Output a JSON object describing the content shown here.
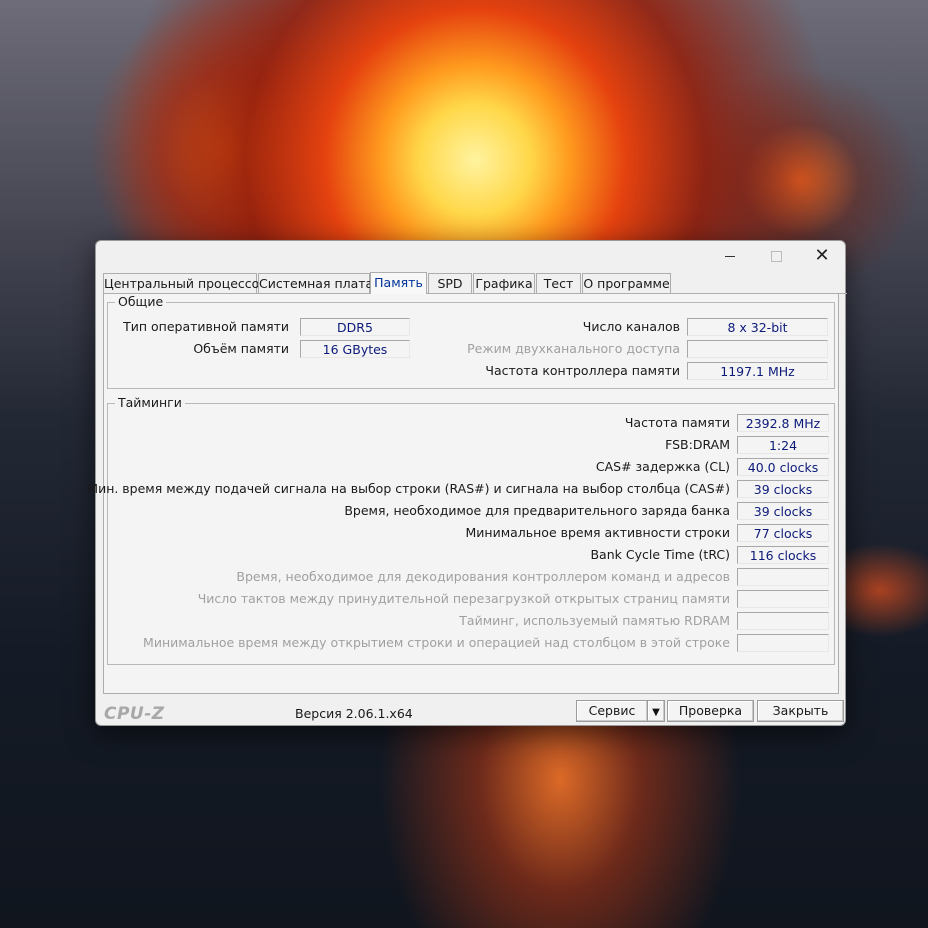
{
  "window": {
    "controls": {
      "minimize": "—",
      "maximize": "□",
      "close": "✕"
    }
  },
  "tabs": [
    {
      "label": "Центральный процессор",
      "active": false
    },
    {
      "label": "Системная плата",
      "active": false
    },
    {
      "label": "Память",
      "active": true
    },
    {
      "label": "SPD",
      "active": false
    },
    {
      "label": "Графика",
      "active": false
    },
    {
      "label": "Тест",
      "active": false
    },
    {
      "label": "О программе",
      "active": false
    }
  ],
  "general": {
    "title": "Общие",
    "mem_type_label": "Тип оперативной памяти",
    "mem_type_value": "DDR5",
    "mem_size_label": "Объём памяти",
    "mem_size_value": "16 GBytes",
    "channels_label": "Число каналов",
    "channels_value": "8 x 32-bit",
    "dual_mode_label": "Режим двухканального доступа",
    "dual_mode_value": "",
    "controller_freq_label": "Частота контроллера памяти",
    "controller_freq_value": "1197.1 MHz"
  },
  "timings": {
    "title": "Тайминги",
    "rows": [
      {
        "label": "Частота памяти",
        "value": "2392.8 MHz",
        "enabled": true
      },
      {
        "label": "FSB:DRAM",
        "value": "1:24",
        "enabled": true
      },
      {
        "label": "CAS# задержка (CL)",
        "value": "40.0 clocks",
        "enabled": true
      },
      {
        "label": "Мин. время между подачей сигнала на выбор строки (RAS#) и сигнала на выбор столбца (CAS#)",
        "value": "39 clocks",
        "enabled": true
      },
      {
        "label": "Время, необходимое для предварительного заряда банка",
        "value": "39 clocks",
        "enabled": true
      },
      {
        "label": "Минимальное время активности строки",
        "value": "77 clocks",
        "enabled": true
      },
      {
        "label": "Bank Cycle Time (tRC)",
        "value": "116 clocks",
        "enabled": true
      },
      {
        "label": "Время, необходимое для декодирования контроллером команд и адресов",
        "value": "",
        "enabled": false
      },
      {
        "label": "Число тактов между принудительной перезагрузкой открытых страниц памяти",
        "value": "",
        "enabled": false
      },
      {
        "label": "Тайминг, используемый памятью RDRAM",
        "value": "",
        "enabled": false
      },
      {
        "label": "Минимальное время между открытием строки и операцией над столбцом в этой строке",
        "value": "",
        "enabled": false
      }
    ]
  },
  "footer": {
    "logo": "CPU-Z",
    "version": "Версия 2.06.1.x64",
    "service_button": "Сервис",
    "dropdown_arrow": "▼",
    "validate_button": "Проверка",
    "close_button": "Закрыть"
  }
}
